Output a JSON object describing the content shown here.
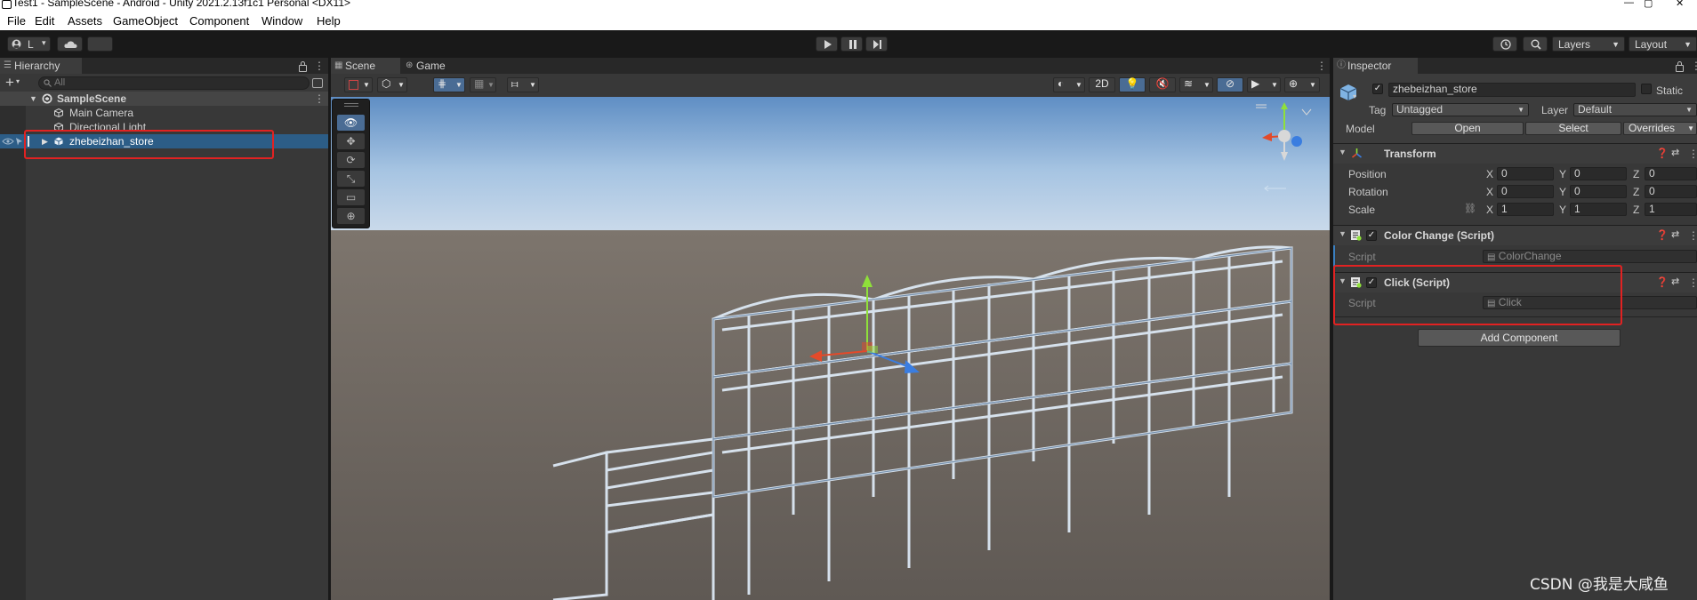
{
  "window": {
    "title": "Test1 - SampleScene - Android - Unity 2021.2.13f1c1 Personal <DX11>"
  },
  "menu": [
    "File",
    "Edit",
    "Assets",
    "GameObject",
    "Component",
    "Window",
    "Help"
  ],
  "toolbar": {
    "account_label": "L",
    "layers_label": "Layers",
    "layout_label": "Layout"
  },
  "hierarchy": {
    "tab_label": "Hierarchy",
    "search_placeholder": "All",
    "scene_name": "SampleScene",
    "items": [
      {
        "label": "Main Camera"
      },
      {
        "label": "Directional Light"
      },
      {
        "label": "zhebeizhan_store"
      }
    ]
  },
  "scene": {
    "tabs": [
      "Scene",
      "Game"
    ],
    "toolbar": {
      "mode_2d": "2D"
    }
  },
  "inspector": {
    "tab_label": "Inspector",
    "object_name": "zhebeizhan_store",
    "static_label": "Static",
    "tag_label": "Tag",
    "tag_value": "Untagged",
    "layer_label": "Layer",
    "layer_value": "Default",
    "model_label": "Model",
    "model_open": "Open",
    "model_select": "Select",
    "model_overrides": "Overrides",
    "transform": {
      "title": "Transform",
      "rows": [
        {
          "label": "Position",
          "x": "0",
          "y": "0",
          "z": "0"
        },
        {
          "label": "Rotation",
          "x": "0",
          "y": "0",
          "z": "0"
        },
        {
          "label": "Scale",
          "x": "1",
          "y": "1",
          "z": "1"
        }
      ],
      "axis_x": "X",
      "axis_y": "Y",
      "axis_z": "Z"
    },
    "components": [
      {
        "title": "Color Change (Script)",
        "script_label": "Script",
        "script_value": "ColorChange"
      },
      {
        "title": "Click (Script)",
        "script_label": "Script",
        "script_value": "Click"
      }
    ],
    "add_component": "Add Component"
  },
  "watermark": "CSDN @我是大咸鱼",
  "colors": {
    "selection": "#2c5d87",
    "highlight_box": "#e12222",
    "panel": "#383838",
    "toolbar": "#191919"
  }
}
